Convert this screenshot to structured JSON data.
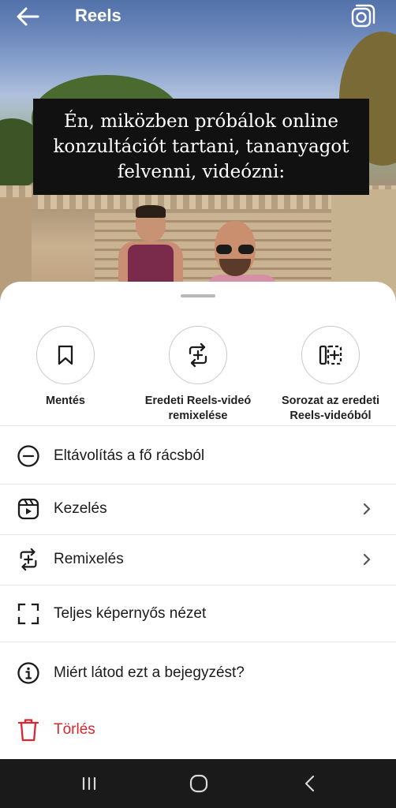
{
  "topbar": {
    "title": "Reels",
    "back_icon": "arrow-left-icon",
    "camera_icon": "camera-icon"
  },
  "video": {
    "caption": "Én, miközben próbálok online konzultációt tartani, tananyagot felvenni, videózni:"
  },
  "sheet": {
    "actions": [
      {
        "label": "Mentés",
        "icon": "bookmark-icon"
      },
      {
        "label": "Eredeti Reels-videó remixelése",
        "icon": "remix-icon"
      },
      {
        "label": "Sorozat az eredeti Reels-videóból",
        "icon": "sequence-icon"
      }
    ],
    "rows": [
      {
        "label": "Eltávolítás a fő rácsból",
        "icon": "minus-circle-icon",
        "chevron": false
      },
      {
        "label": "Kezelés",
        "icon": "reels-icon",
        "chevron": true
      },
      {
        "label": "Remixelés",
        "icon": "remix-icon",
        "chevron": true
      },
      {
        "label": "Teljes képernyős nézet",
        "icon": "fullscreen-icon",
        "chevron": false
      },
      {
        "label": "Miért látod ezt a bejegyzést?",
        "icon": "info-icon",
        "chevron": false
      },
      {
        "label": "Törlés",
        "icon": "trash-icon",
        "chevron": false
      }
    ]
  },
  "colors": {
    "danger": "#d9262f",
    "sheet_bg": "#ffffff",
    "navbar_bg": "#1a1a1a"
  },
  "navbar": {
    "buttons": [
      "recent-apps-icon",
      "home-icon",
      "back-icon"
    ]
  }
}
